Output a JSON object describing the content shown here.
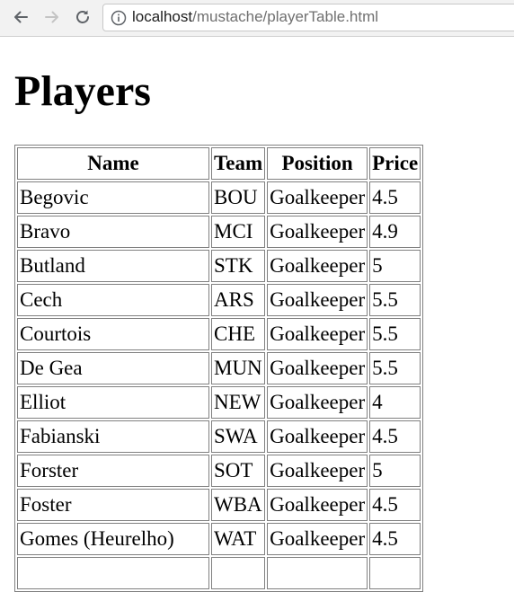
{
  "browser": {
    "url_host": "localhost",
    "url_path": "/mustache/playerTable.html"
  },
  "page": {
    "title": "Players"
  },
  "table": {
    "headers": [
      "Name",
      "Team",
      "Position",
      "Price"
    ],
    "rows": [
      [
        "Begovic",
        "BOU",
        "Goalkeeper",
        "4.5"
      ],
      [
        "Bravo",
        "MCI",
        "Goalkeeper",
        "4.9"
      ],
      [
        "Butland",
        "STK",
        "Goalkeeper",
        "5"
      ],
      [
        "Cech",
        "ARS",
        "Goalkeeper",
        "5.5"
      ],
      [
        "Courtois",
        "CHE",
        "Goalkeeper",
        "5.5"
      ],
      [
        "De Gea",
        "MUN",
        "Goalkeeper",
        "5.5"
      ],
      [
        "Elliot",
        "NEW",
        "Goalkeeper",
        "4"
      ],
      [
        "Fabianski",
        "SWA",
        "Goalkeeper",
        "4.5"
      ],
      [
        "Forster",
        "SOT",
        "Goalkeeper",
        "5"
      ],
      [
        "Foster",
        "WBA",
        "Goalkeeper",
        "4.5"
      ],
      [
        "Gomes (Heurelho)",
        "WAT",
        "Goalkeeper",
        "4.5"
      ],
      [
        "",
        "",
        "",
        ""
      ]
    ]
  }
}
